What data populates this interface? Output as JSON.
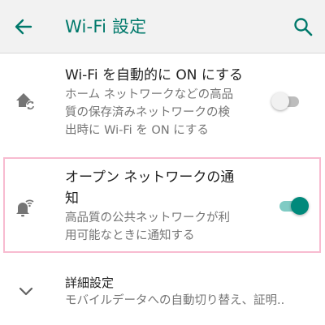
{
  "appbar": {
    "title": "Wi-Fi 設定",
    "back_icon": "arrow-back-icon",
    "search_icon": "search-icon"
  },
  "settings": [
    {
      "title": "Wi-Fi を自動的に ON にする",
      "summary_lines": [
        "ホーム ネットワークなどの高品",
        "質の保存済みネットワークの検",
        "出時に Wi-Fi を ON にする"
      ],
      "icon": "wifi-home-auto-icon",
      "toggle_on": false
    },
    {
      "title_lines": [
        "オープン ネットワークの通",
        "知"
      ],
      "summary_lines": [
        "高品質の公共ネットワークが利",
        "用可能なときに通知する"
      ],
      "icon": "notification-wifi-icon",
      "toggle_on": true
    },
    {
      "title": "詳細設定",
      "summary": "モバイルデータへの自動切り替え、証明..",
      "icon": "chevron-down-icon"
    }
  ],
  "colors": {
    "accent": "#00796b",
    "toggle_on_thumb": "#00897b",
    "toggle_on_track": "#80cbc4",
    "highlight_border": "#f8bbd0"
  }
}
